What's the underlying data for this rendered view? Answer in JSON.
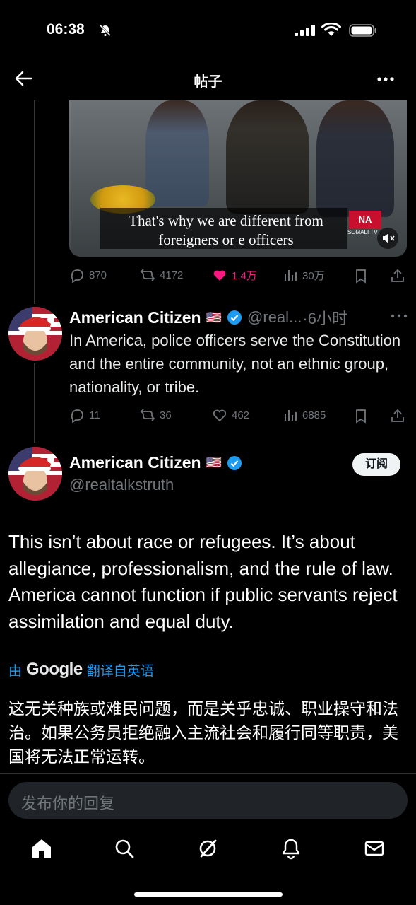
{
  "status_bar": {
    "time": "06:38"
  },
  "header": {
    "title": "帖子"
  },
  "video": {
    "caption_line1": "That's why we are different from",
    "caption_line2": "foreigners or        e officers",
    "logo": "NA",
    "logo_sub": "SOMALI TV"
  },
  "parent_actions": {
    "replies": "870",
    "reposts": "4172",
    "likes": "1.4万",
    "views": "30万",
    "like_color": "#f91880"
  },
  "reply_tweet": {
    "name": "American Citizen",
    "flag": "🇺🇸",
    "handle": "@real...",
    "time": "·6小时",
    "text": "In America, police officers serve the Constitution and the entire community, not an ethnic group, nationality, or tribe.",
    "replies": "11",
    "reposts": "36",
    "likes": "462",
    "views": "6885"
  },
  "main_tweet": {
    "name": "American Citizen",
    "flag": "🇺🇸",
    "handle": "@realtalkstruth",
    "subscribe_label": "订阅",
    "text": "This isn’t about race or refugees. It’s about allegiance, professionalism, and the rule of law. America cannot function if public servants reject assimilation and equal duty.",
    "translate_prefix": "由",
    "translate_brand": "Google",
    "translate_suffix": "翻译自英语",
    "translated_text": "这无关种族或难民问题，而是关乎忠诚、职业操守和法治。如果公务员拒绝融入主流社会和履行同等职责，美国将无法正常运转。"
  },
  "reply_input": {
    "placeholder": "发布你的回复"
  },
  "colors": {
    "accent": "#1d9bf0",
    "verified": "#1d9bf0",
    "background": "#000000"
  },
  "bottom_nav": [
    "home-icon",
    "search-icon",
    "grok-icon",
    "notifications-icon",
    "messages-icon"
  ]
}
